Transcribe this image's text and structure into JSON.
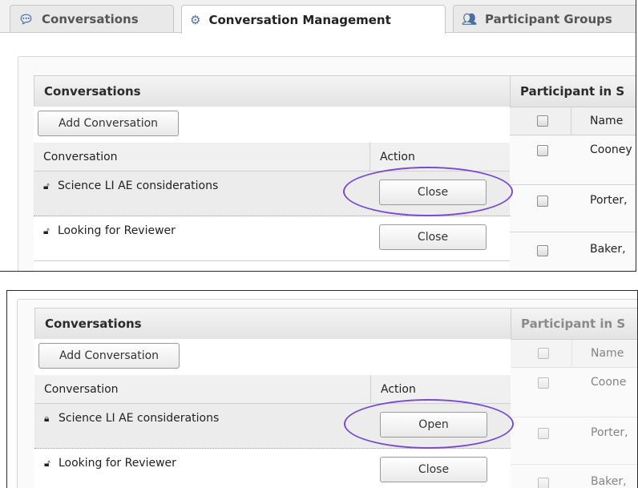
{
  "tabs": [
    {
      "label": "Conversations",
      "icon": "chat-bubbles-icon",
      "active": false
    },
    {
      "label": "Conversation Management",
      "icon": "gears-icon",
      "active": true
    },
    {
      "label": "Participant Groups",
      "icon": "group-icon",
      "active": false
    }
  ],
  "before": {
    "panel_title": "Conversations",
    "add_button": "Add Conversation",
    "columns": {
      "conversation": "Conversation",
      "action": "Action"
    },
    "rows": [
      {
        "name": "Science LI AE considerations",
        "lock": "unlocked-icon",
        "action": "Close"
      },
      {
        "name": "Looking for Reviewer",
        "lock": "unlocked-icon",
        "action": "Close"
      }
    ],
    "participants": {
      "title": "Participant in S",
      "name_header": "Name",
      "rows": [
        "Cooney",
        "Porter,",
        "Baker,"
      ]
    }
  },
  "after": {
    "panel_title": "Conversations",
    "add_button": "Add Conversation",
    "columns": {
      "conversation": "Conversation",
      "action": "Action"
    },
    "rows": [
      {
        "name": "Science LI AE considerations",
        "lock": "locked-icon",
        "action": "Open"
      },
      {
        "name": "Looking for Reviewer",
        "lock": "unlocked-icon",
        "action": "Close"
      }
    ],
    "participants": {
      "title": "Participant in S",
      "name_header": "Name",
      "rows": [
        "Coone",
        "Porter,",
        "Baker,"
      ]
    }
  },
  "colors": {
    "highlight_circle": "#7a4ad6",
    "tab_icon": "#4d6f9f"
  }
}
